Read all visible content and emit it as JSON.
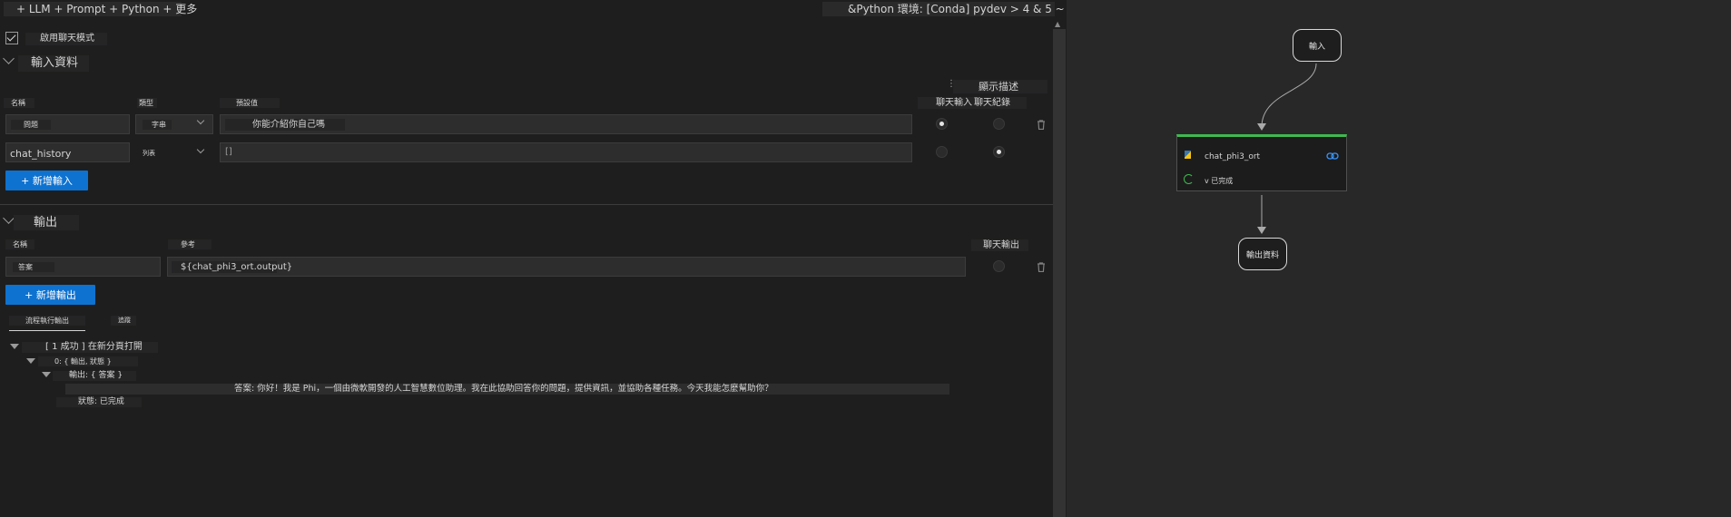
{
  "toolbar": {
    "left_label": "+ LLM + Prompt + Python + 更多",
    "right_label": "&Python 環境: [Conda] pydev > 4 & 5 ~"
  },
  "chat_mode": {
    "label": "啟用聊天模式",
    "checked": true
  },
  "inputs": {
    "title": "輸入資料",
    "show_desc": "顯示描述",
    "col_name": "名稱",
    "col_type": "類型",
    "col_default": "預設值",
    "col_chat_input": "聊天輸入",
    "col_chat_history": "聊天紀錄",
    "rows": [
      {
        "name": "問題",
        "type": "字串",
        "value": "你能介紹你自己嗎",
        "chat_input": true,
        "chat_history": false
      },
      {
        "name": "chat_history",
        "type": "列表",
        "value": "[]",
        "chat_input": false,
        "chat_history": true
      }
    ],
    "add_button": "+ 新增輸入"
  },
  "outputs": {
    "title": "輸出",
    "col_name": "名稱",
    "col_ref": "參考",
    "col_chat_output": "聊天輸出",
    "rows": [
      {
        "name": "答案",
        "ref": "${chat_phi3_ort.output}"
      }
    ],
    "add_button": "+ 新增輸出"
  },
  "run_tabs": {
    "active": "流程執行輸出",
    "other": "追蹤"
  },
  "tree": {
    "root": "[ 1 成功 ] 在新分頁打開",
    "item0": "0: { 輸出, 狀態 }",
    "output": "輸出: { 答案 }",
    "answer": "答案: 你好！我是 Phi，一個由微軟開發的人工智慧數位助理。我在此協助回答你的問題，提供資訊，並協助各種任務。今天我能怎麼幫助你？",
    "status": "狀態: 已完成"
  },
  "graph": {
    "input_node": "輸入",
    "llm_node": "chat_phi3_ort",
    "llm_status": "v 已完成",
    "output_node": "輸出資料",
    "accent": "#3fb950"
  }
}
